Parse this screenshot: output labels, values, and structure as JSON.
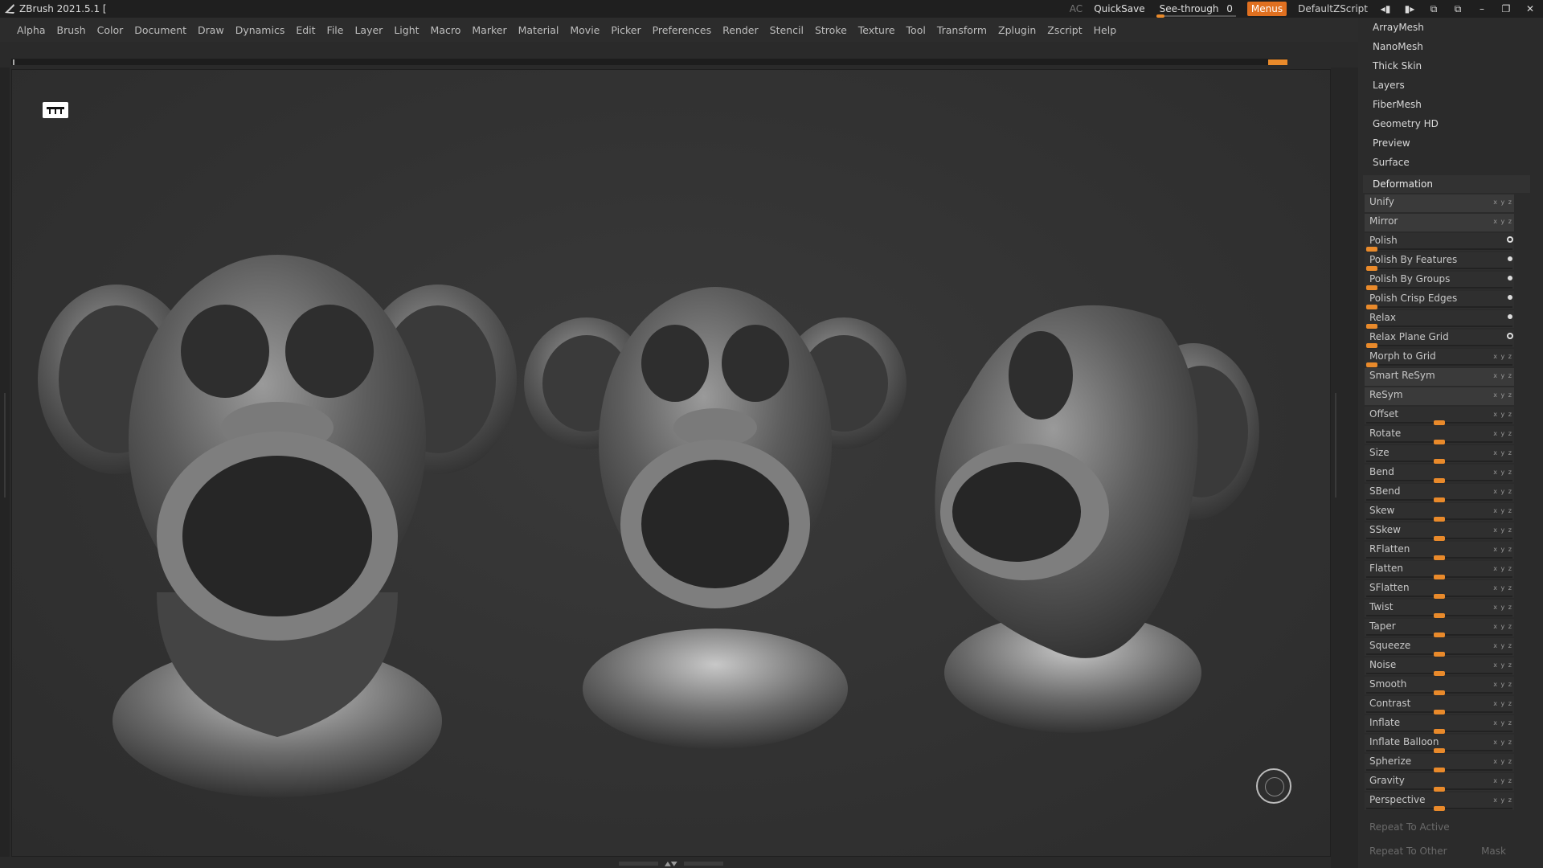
{
  "titlebar": {
    "app_title": "ZBrush 2021.5.1 [",
    "ac": "AC",
    "quicksave": "QuickSave",
    "see_through_label": "See-through",
    "see_through_value": "0",
    "menus": "Menus",
    "default_zscript": "DefaultZScript"
  },
  "menubar": {
    "items": [
      "Alpha",
      "Brush",
      "Color",
      "Document",
      "Draw",
      "Dynamics",
      "Edit",
      "File",
      "Layer",
      "Light",
      "Macro",
      "Marker",
      "Material",
      "Movie",
      "Picker",
      "Preferences",
      "Render",
      "Stencil",
      "Stroke",
      "Texture",
      "Tool",
      "Transform",
      "Zplugin",
      "Zscript",
      "Help"
    ]
  },
  "panel": {
    "subpalettes": [
      "ArrayMesh",
      "NanoMesh",
      "Thick Skin",
      "Layers",
      "FiberMesh",
      "Geometry HD",
      "Preview",
      "Surface"
    ],
    "section_title": "Deformation",
    "rows": [
      {
        "label": "Unify",
        "kind": "button"
      },
      {
        "label": "Mirror",
        "kind": "button"
      },
      {
        "label": "Polish",
        "kind": "slider-ring"
      },
      {
        "label": "Polish By Features",
        "kind": "slider-dot"
      },
      {
        "label": "Polish By Groups",
        "kind": "slider-dot"
      },
      {
        "label": "Polish Crisp Edges",
        "kind": "slider-dot"
      },
      {
        "label": "Relax",
        "kind": "slider-dot"
      },
      {
        "label": "Relax Plane Grid",
        "kind": "slider-ring"
      },
      {
        "label": "Morph to Grid",
        "kind": "slider"
      },
      {
        "label": "Smart ReSym",
        "kind": "button"
      },
      {
        "label": "ReSym",
        "kind": "button"
      },
      {
        "label": "Offset",
        "kind": "axis"
      },
      {
        "label": "Rotate",
        "kind": "axis"
      },
      {
        "label": "Size",
        "kind": "axis"
      },
      {
        "label": "Bend",
        "kind": "axis"
      },
      {
        "label": "SBend",
        "kind": "axis"
      },
      {
        "label": "Skew",
        "kind": "axis"
      },
      {
        "label": "SSkew",
        "kind": "axis"
      },
      {
        "label": "RFlatten",
        "kind": "axis"
      },
      {
        "label": "Flatten",
        "kind": "axis"
      },
      {
        "label": "SFlatten",
        "kind": "axis"
      },
      {
        "label": "Twist",
        "kind": "axis"
      },
      {
        "label": "Taper",
        "kind": "axis"
      },
      {
        "label": "Squeeze",
        "kind": "axis"
      },
      {
        "label": "Noise",
        "kind": "axis"
      },
      {
        "label": "Smooth",
        "kind": "axis"
      },
      {
        "label": "Contrast",
        "kind": "axis"
      },
      {
        "label": "Inflate",
        "kind": "axis"
      },
      {
        "label": "Inflate Balloon",
        "kind": "axis"
      },
      {
        "label": "Spherize",
        "kind": "axis"
      },
      {
        "label": "Gravity",
        "kind": "axis"
      },
      {
        "label": "Perspective",
        "kind": "axis"
      }
    ],
    "repeat_to_active": "Repeat To Active",
    "repeat_to_other": "Repeat To Other",
    "mask": "Mask",
    "flag_text": "x y z"
  },
  "colors": {
    "accent": "#e98a2b",
    "menus_button": "#e07020",
    "background": "#2a2a2a"
  }
}
